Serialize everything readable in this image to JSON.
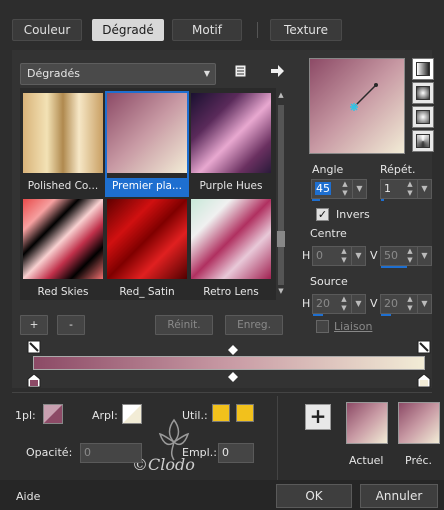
{
  "tabs": [
    "Couleur",
    "Dégradé",
    "Motif",
    "Texture"
  ],
  "gradient_dropdown": "Dégradés",
  "thumbnails": [
    {
      "label": "Polished Co..."
    },
    {
      "label": "Premier pla..."
    },
    {
      "label": "Purple Hues"
    },
    {
      "label": "Red Skies"
    },
    {
      "label": "Red_ Satin"
    },
    {
      "label": "Retro Lens"
    }
  ],
  "buttons": {
    "plus": "+",
    "minus": "-",
    "reinit": "Réinit.",
    "enreg": "Enreg."
  },
  "angle": {
    "label": "Angle",
    "value": "45"
  },
  "repet": {
    "label": "Répét.",
    "value": "1"
  },
  "invers": {
    "label": "Invers",
    "checked": true
  },
  "centre": {
    "label": "Centre",
    "h_label": "H",
    "h_value": "0",
    "v_label": "V",
    "v_value": "50"
  },
  "source": {
    "label": "Source",
    "h_label": "H",
    "h_value": "20",
    "v_label": "V",
    "v_value": "20"
  },
  "liaison": {
    "label": "Liaison",
    "checked": false
  },
  "bottom": {
    "opl_label": "1pl:",
    "arpl_label": "Arpl:",
    "util_label": "Util.:",
    "opacite_label": "Opacité:",
    "opacite_value": "0",
    "empl_label": "Empl.:",
    "empl_value": "0",
    "actuel_label": "Actuel",
    "prec_label": "Préc.",
    "add_label": "+"
  },
  "footer": {
    "aide": "Aide",
    "ok": "OK",
    "annuler": "Annuler"
  },
  "watermark": "©Clodo",
  "colors": {
    "background": "#2d2d2d",
    "selected": "#1e6fd0",
    "util_color": "#f2c11c",
    "gradient_start": "#8c4a66",
    "gradient_end": "#f2ecd6"
  }
}
